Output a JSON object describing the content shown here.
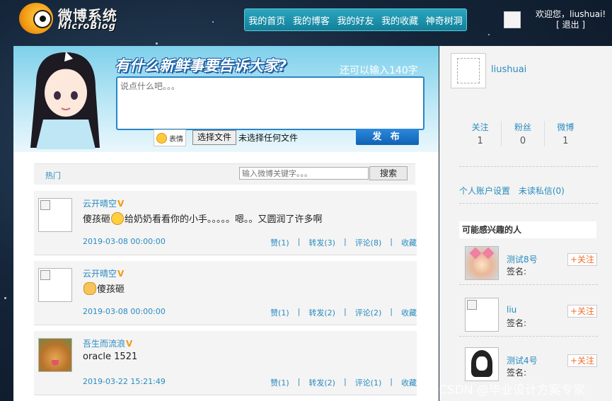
{
  "logo": {
    "cn": "微博系统",
    "en": "MicroBlog"
  },
  "nav": [
    "我的首页",
    "我的博客",
    "我的好友",
    "我的收藏",
    "神奇树洞"
  ],
  "header": {
    "welcome": "欢迎您，liushuai!",
    "logout": "[ 退出 ]"
  },
  "composer": {
    "slogan": "有什么新鲜事要告诉大家?",
    "count": "还可以输入140字",
    "placeholder": "说点什么吧。。。",
    "emoji_label": "表情",
    "file_button": "选择文件",
    "file_status": "未选择任何文件",
    "publish": "发 布"
  },
  "feed_bar": {
    "hot": "热门",
    "search_placeholder": "输入微博关键字。。。",
    "search_button": "搜索"
  },
  "posts": [
    {
      "name": "云开晴空",
      "content_before": "傻孩砸",
      "content_after": "给奶奶看看你的小手。。。。。嗯。。又圆润了许多啊",
      "time": "2019-03-08 00:00:00",
      "like": "赞(1)",
      "repost": "转发(3)",
      "comment": "评论(8)",
      "fav": "收藏"
    },
    {
      "name": "云开晴空",
      "content_before": "",
      "content_after": "傻孩砸",
      "time": "2019-03-08 00:00:00",
      "like": "赞(1)",
      "repost": "转发(2)",
      "comment": "评论(2)",
      "fav": "收藏"
    },
    {
      "name": "吾生而流浪",
      "content_before": "",
      "content_after": "oracle 1521",
      "time": "2019-03-22 15:21:49",
      "like": "赞(1)",
      "repost": "转发(2)",
      "comment": "评论(1)",
      "fav": "收藏"
    }
  ],
  "sidebar": {
    "username": "liushuai",
    "stats": [
      {
        "label": "关注",
        "value": "1"
      },
      {
        "label": "粉丝",
        "value": "0"
      },
      {
        "label": "微博",
        "value": "1"
      }
    ],
    "links": [
      "个人账户设置",
      "未读私信(0)"
    ],
    "may_like_title": "可能感兴趣的人",
    "recommend": [
      {
        "name": "测试8号",
        "sig": "签名:",
        "follow": "+关注"
      },
      {
        "name": "liu",
        "sig": "签名:",
        "follow": "+关注"
      },
      {
        "name": "测试4号",
        "sig": "签名:",
        "follow": "+关注"
      }
    ]
  },
  "watermark": "CSDN @毕业设计方案专家"
}
